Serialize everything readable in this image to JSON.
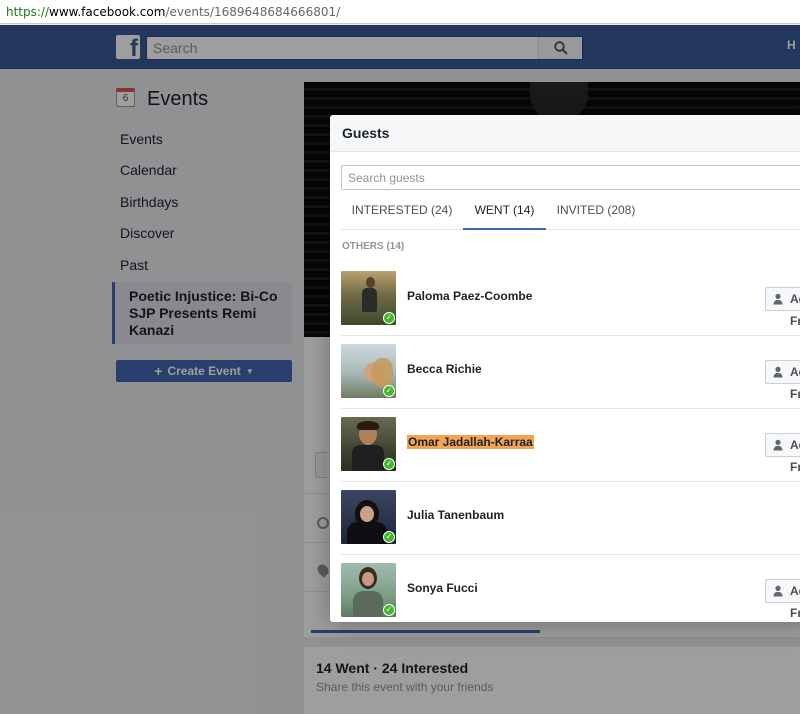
{
  "browser": {
    "url_scheme": "https://",
    "url_domain": "www.facebook.com",
    "url_path": "/events/1689648684666801/"
  },
  "header": {
    "search_placeholder": "Search",
    "home_link": "H",
    "brand_color": "#3b5998"
  },
  "nav": {
    "calendar_day": "6",
    "title": "Events",
    "items": [
      {
        "label": "Events"
      },
      {
        "label": "Calendar"
      },
      {
        "label": "Birthdays"
      },
      {
        "label": "Discover"
      },
      {
        "label": "Past"
      }
    ],
    "active_event": "Poetic Injustice: Bi-Co SJP Presents Remi Kanazi",
    "create_label": "Create Event"
  },
  "event": {
    "went_summary": "14 Went · 24 Interested",
    "share_prompt": "Share this event with your friends"
  },
  "modal": {
    "title": "Guests",
    "search_placeholder": "Search guests",
    "tabs": [
      {
        "label": "INTERESTED (24)"
      },
      {
        "label": "WENT (14)"
      },
      {
        "label": "INVITED (208)"
      }
    ],
    "section_label": "OTHERS (14)",
    "add_label": "Add Friend",
    "guests": [
      {
        "name": "Paloma Paez-Coombe",
        "has_add": true
      },
      {
        "name": "Becca Richie",
        "has_add": true
      },
      {
        "name": "Omar Jadallah-Karraa",
        "has_add": true,
        "highlight": "#f2a452"
      },
      {
        "name": "Julia Tanenbaum",
        "has_add": false
      },
      {
        "name": "Sonya Fucci",
        "has_add": true
      }
    ]
  }
}
